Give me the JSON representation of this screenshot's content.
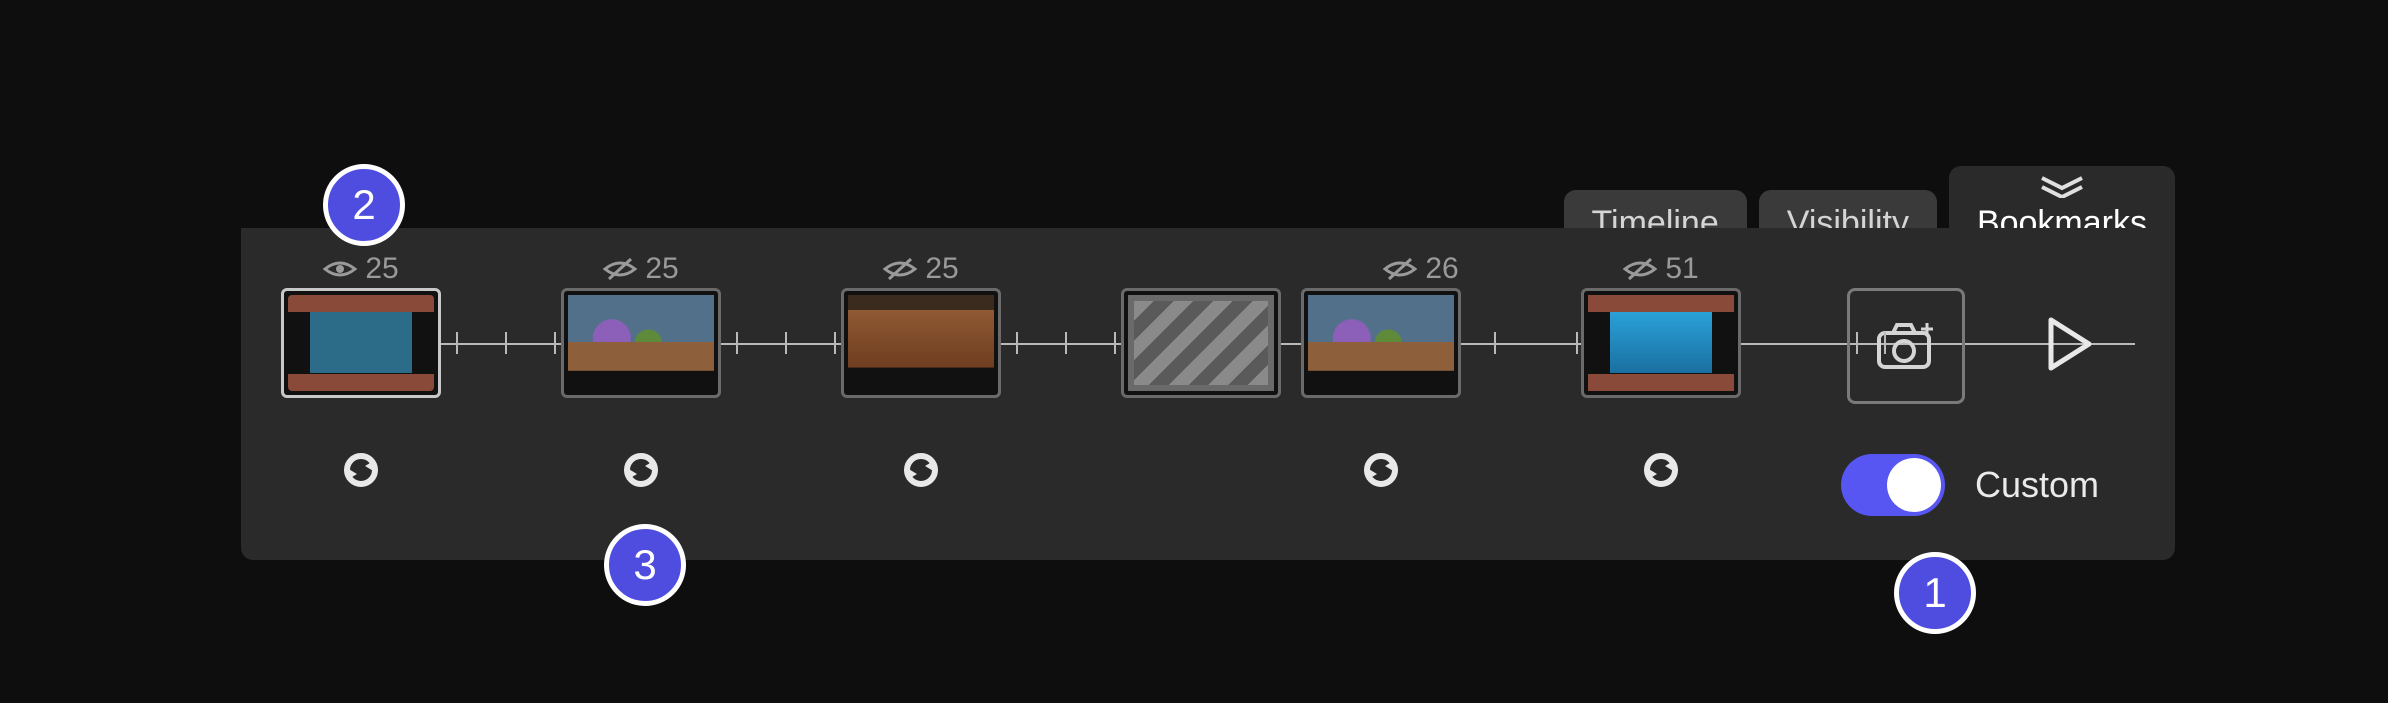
{
  "tabs": {
    "timeline": "Timeline",
    "visibility": "Visibility",
    "bookmarks": "Bookmarks",
    "active": "bookmarks"
  },
  "keyframes": [
    {
      "visible": true,
      "count": 25,
      "scene": "stage",
      "selected": true
    },
    {
      "visible": false,
      "count": 25,
      "scene": "chars",
      "selected": false
    },
    {
      "visible": false,
      "count": 25,
      "scene": "floor",
      "selected": false
    },
    {
      "visible": null,
      "count": null,
      "scene": "stripe",
      "selected": false
    },
    {
      "visible": false,
      "count": 26,
      "scene": "chars",
      "selected": false
    },
    {
      "visible": false,
      "count": 51,
      "scene": "aqua",
      "selected": false
    }
  ],
  "sync_buttons": [
    true,
    true,
    true,
    false,
    true,
    true
  ],
  "capture_label": "capture",
  "play_label": "play",
  "custom_toggle": {
    "label": "Custom",
    "on": true
  },
  "callouts": {
    "c1": "1",
    "c2": "2",
    "c3": "3"
  }
}
